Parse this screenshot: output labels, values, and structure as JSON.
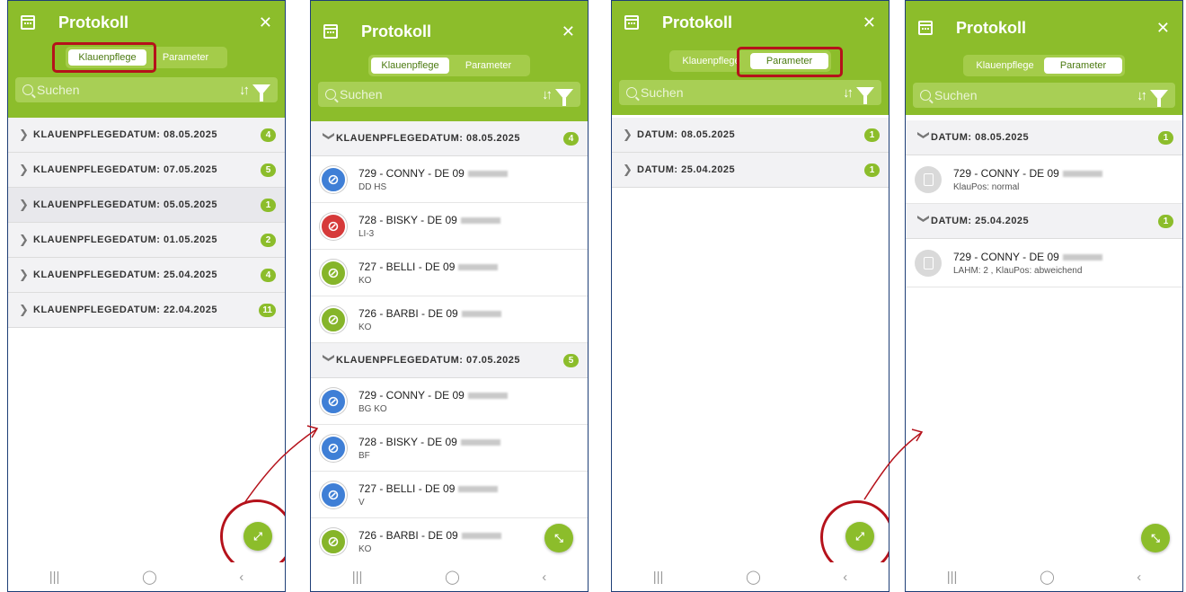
{
  "title": "Protokoll",
  "tabs": [
    "Klauenpflege",
    "Parameter"
  ],
  "search_placeholder": "Suchen",
  "icons": {
    "sort": "sort-arrows-icon",
    "filter": "filter-funnel-icon",
    "calendar": "calendar-icon",
    "close": "close-icon"
  },
  "colors": {
    "brand_green": "#8cbd2b",
    "highlight_red": "#b5121b",
    "hoof_blue": "#3f7fd6",
    "hoof_red": "#d63a3a",
    "hoof_green": "#86b52a"
  },
  "screen1": {
    "groups": [
      {
        "label": "KLAUENPFLEGEDATUM: 08.05.2025",
        "count": "4"
      },
      {
        "label": "KLAUENPFLEGEDATUM: 07.05.2025",
        "count": "5"
      },
      {
        "label": "KLAUENPFLEGEDATUM: 05.05.2025",
        "count": "1"
      },
      {
        "label": "KLAUENPFLEGEDATUM: 01.05.2025",
        "count": "2"
      },
      {
        "label": "KLAUENPFLEGEDATUM: 25.04.2025",
        "count": "4"
      },
      {
        "label": "KLAUENPFLEGEDATUM: 22.04.2025",
        "count": "11"
      }
    ]
  },
  "screen2": {
    "group_a": {
      "label": "KLAUENPFLEGEDATUM: 08.05.2025",
      "count": "4"
    },
    "items_a": [
      {
        "name": "729 - CONNY - DE 09",
        "sub": "DD HS",
        "color": "blue"
      },
      {
        "name": "728 - BISKY - DE 09",
        "sub": "LI-3",
        "color": "red"
      },
      {
        "name": "727 - BELLI - DE 09",
        "sub": "KO",
        "color": "green"
      },
      {
        "name": "726 - BARBI - DE 09",
        "sub": "KO",
        "color": "green"
      }
    ],
    "group_b": {
      "label": "KLAUENPFLEGEDATUM: 07.05.2025",
      "count": "5"
    },
    "items_b": [
      {
        "name": "729 - CONNY - DE 09",
        "sub": "BG KO",
        "color": "blue"
      },
      {
        "name": "728 - BISKY - DE 09",
        "sub": "BF",
        "color": "blue"
      },
      {
        "name": "727 - BELLI - DE 09",
        "sub": "V",
        "color": "blue"
      },
      {
        "name": "726 - BARBI - DE 09",
        "sub": "KO",
        "color": "green"
      }
    ]
  },
  "screen3": {
    "groups": [
      {
        "label": "DATUM: 08.05.2025",
        "count": "1"
      },
      {
        "label": "DATUM: 25.04.2025",
        "count": "1"
      }
    ]
  },
  "screen4": {
    "group_a": {
      "label": "DATUM: 08.05.2025",
      "count": "1"
    },
    "item_a": {
      "name": "729 - CONNY - DE 09",
      "sub": "KlauPos: normal"
    },
    "group_b": {
      "label": "DATUM: 25.04.2025",
      "count": "1"
    },
    "item_b": {
      "name": "729 - CONNY - DE 09",
      "sub": "LAHM: 2 , KlauPos: abweichend"
    }
  },
  "nav": {
    "recent": "|||",
    "home": "◯",
    "back": "‹"
  }
}
